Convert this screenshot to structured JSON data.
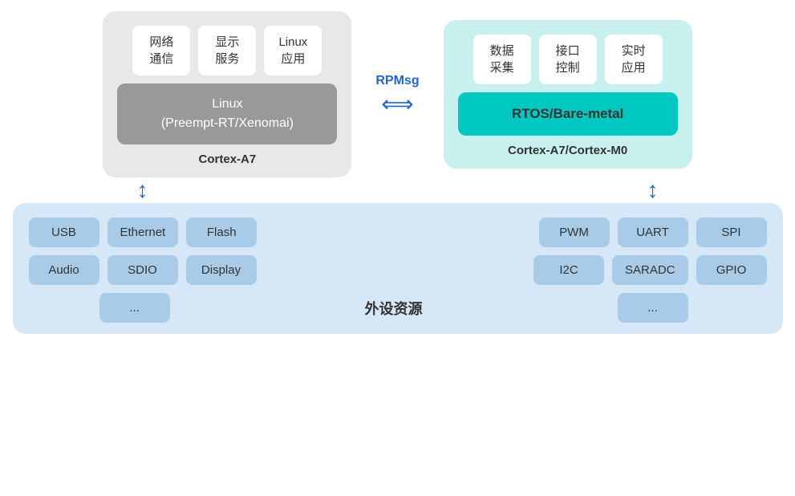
{
  "linux_box": {
    "apps": [
      {
        "label": "网络\n通信"
      },
      {
        "label": "显示\n服务"
      },
      {
        "label": "Linux\n应用"
      }
    ],
    "kernel": "Linux\n(Preempt-RT/Xenomai)",
    "cortex_label": "Cortex-A7"
  },
  "rpmsg": {
    "label": "RPMsg",
    "arrow": "↔"
  },
  "rtos_box": {
    "apps": [
      {
        "label": "数据\n采集"
      },
      {
        "label": "接口\n控制"
      },
      {
        "label": "实时\n应用"
      }
    ],
    "kernel": "RTOS/Bare-metal",
    "cortex_label": "Cortex-A7/Cortex-M0"
  },
  "peripheral_box": {
    "left_row1": [
      "USB",
      "Ethernet",
      "Flash"
    ],
    "left_row2": [
      "Audio",
      "SDIO",
      "Display"
    ],
    "left_row3": [
      "..."
    ],
    "right_row1": [
      "PWM",
      "UART",
      "SPI"
    ],
    "right_row2": [
      "I2C",
      "SARADC",
      "GPIO"
    ],
    "right_row3": [
      "..."
    ],
    "label": "外设资源"
  }
}
